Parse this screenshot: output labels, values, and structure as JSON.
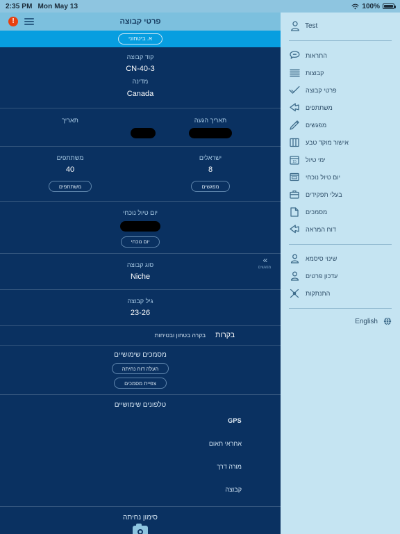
{
  "status_bar": {
    "time": "2:35 PM",
    "date": "Mon May 13",
    "wifi_icon": "wifi-icon",
    "battery_percent": "100%"
  },
  "header": {
    "title": "פרטי קבוצה",
    "alert_icon": "alert-exclamation-icon",
    "alert_glyph": "!",
    "menu_icon": "hamburger-menu-icon"
  },
  "subbar": {
    "security_button": "א. ביטחוני"
  },
  "group_details": {
    "code_label": "קוד קבוצה",
    "code_value": "CN-40-3",
    "country_label": "מדינה",
    "country_value": "Canada",
    "arrival_date_label": "תאריך הגעה",
    "arrival_date_value": "",
    "date_label": "תאריך",
    "date_value": "",
    "israelis_label": "ישראלים",
    "israelis_value": "8",
    "participants_label": "משתתפים",
    "participants_value": "40",
    "meetings_button": "מפגשים",
    "participants_button": "משתתפים",
    "current_day_label": "יום טיול נוכחי",
    "current_day_value": "",
    "current_day_button": "יום נוכחי",
    "group_type_label": "סוג קבוצה",
    "group_type_value": "Niche",
    "group_age_label": "גיל קבוצה",
    "group_age_value": "23-26"
  },
  "tabs": {
    "active": "בקרות",
    "inactive": "בקרה בטחון ובטיחות"
  },
  "documents": {
    "heading": "מסמכים שימושיים",
    "upload_button": "העלה דוח נחיתה",
    "view_button": "צפיית מסמכים"
  },
  "phones": {
    "heading": "טלפונים שימושיים",
    "rows": [
      {
        "label": "GPS",
        "emphasis": true
      },
      {
        "label": "אחראי תאום",
        "emphasis": false
      },
      {
        "label": "מורה דרך",
        "emphasis": false
      },
      {
        "label": "קבוצה",
        "emphasis": false
      }
    ]
  },
  "landing": {
    "heading": "סימון נחיתה",
    "camera_icon": "camera-icon"
  },
  "collapse_handle": {
    "chevron_icon": "chevron-double-right-icon",
    "label": "מפגשים"
  },
  "drawer": {
    "account_name": "Test",
    "account_icon": "user-avatar-icon",
    "language": "English",
    "language_icon": "globe-icon",
    "groups_primary": [
      {
        "label": "התראות",
        "icon": "notification-bubble-icon"
      },
      {
        "label": "קבוצות",
        "icon": "list-lines-icon"
      },
      {
        "label": "פרטי קבוצה",
        "icon": "checkmark-icon"
      },
      {
        "label": "משתתפים",
        "icon": "share-arrow-icon"
      },
      {
        "label": "מפגשים",
        "icon": "pencil-edit-icon"
      },
      {
        "label": "אישור מוקד טבע",
        "icon": "book-open-icon"
      },
      {
        "label": "ימי טיול",
        "icon": "calendar-15-icon"
      },
      {
        "label": "יום טיול נוכחי",
        "icon": "id-card-icon"
      },
      {
        "label": "בעלי תפקידים",
        "icon": "briefcase-icon"
      },
      {
        "label": "מסמכים",
        "icon": "document-page-icon"
      },
      {
        "label": "דוח המראה",
        "icon": "share-arrow-icon"
      }
    ],
    "groups_secondary": [
      {
        "label": "שינוי סיסמא",
        "icon": "user-password-icon"
      },
      {
        "label": "עדכון פרטים",
        "icon": "user-edit-icon"
      },
      {
        "label": "התנתקות",
        "icon": "logout-x-icon"
      }
    ],
    "calendar_day": "15"
  },
  "colors": {
    "page_bg": "#0a3161",
    "navbar": "#7cc0de",
    "subbar": "#079ee0",
    "drawer_bg": "#c5e4f2",
    "alert": "#e8400f",
    "accent_text": "#a9cbe6"
  }
}
